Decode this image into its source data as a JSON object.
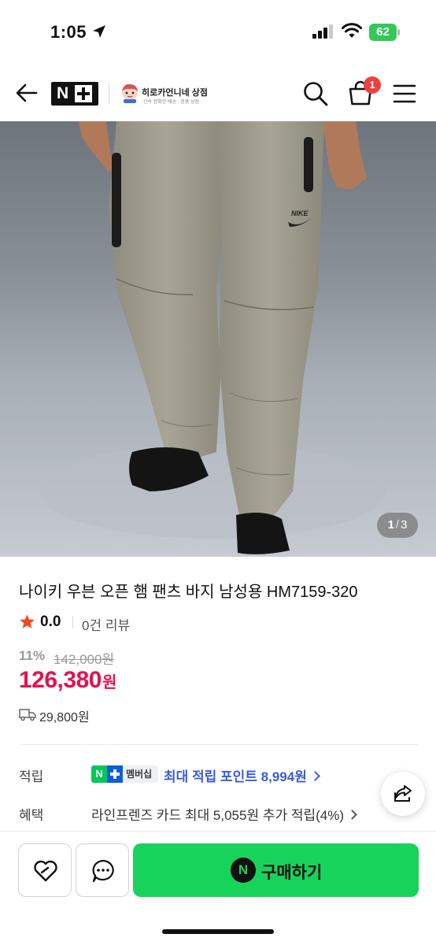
{
  "status_bar": {
    "time": "1:05",
    "battery": "62"
  },
  "header": {
    "logo_text": "N",
    "store_name": "히로카언니네 상점",
    "store_subtitle": "신속 정확한 배송 · 정품 상점",
    "cart_count": "1"
  },
  "gallery": {
    "current": "1",
    "separator": "/",
    "total": "3",
    "logo_mark": "NIKE"
  },
  "product": {
    "title": "나이키 우븐 오픈 햄 팬츠 바지 남성용 HM7159-320",
    "rating": "0.0",
    "review_count": "0건 리뷰",
    "discount": "11%",
    "original_price": "142,000원",
    "price": "126,380",
    "price_unit": "원",
    "shipping_fee": "29,800원"
  },
  "benefits": {
    "points_label": "적립",
    "badge_n": "N",
    "badge_text": "멤버십",
    "points_text": "최대 적립 포인트 8,994원",
    "benefit_label": "혜택",
    "benefit_text": "라인프렌즈 카드 최대 5,055원 추가 적립(4%)"
  },
  "bottom_bar": {
    "buy_icon": "N",
    "buy_label": "구매하기"
  },
  "colors": {
    "accent_green": "#18d35b",
    "price_red": "#e5114e",
    "point_blue": "#3b5bd9",
    "badge_red": "#f23e3e"
  }
}
